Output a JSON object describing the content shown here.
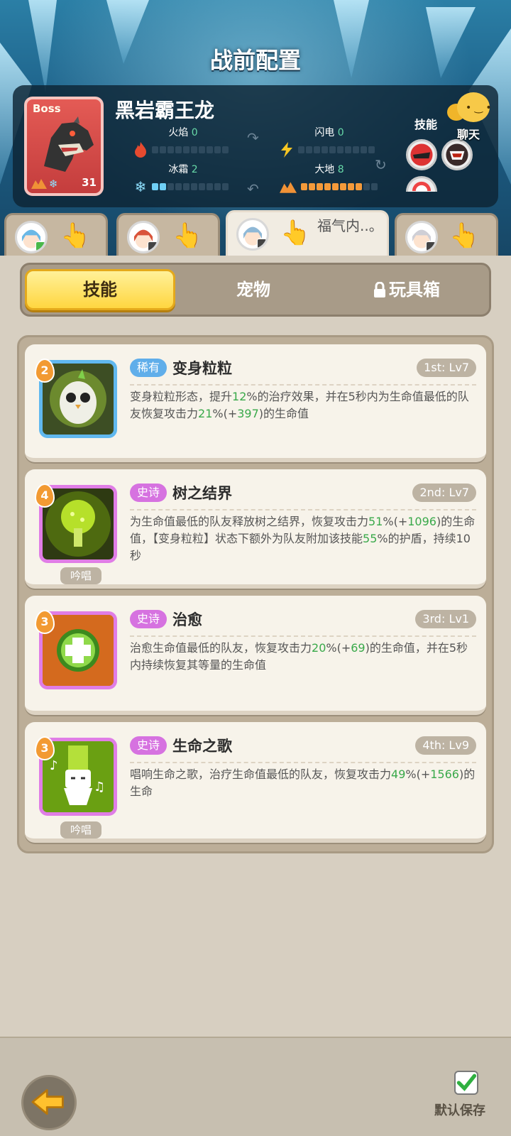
{
  "header": {
    "title": "战前配置"
  },
  "boss": {
    "tag": "Boss",
    "name": "黑岩霸王龙",
    "level": "31",
    "stats": {
      "fire": {
        "label": "火焰",
        "value": "0",
        "filled": 0
      },
      "lightning": {
        "label": "闪电",
        "value": "0",
        "filled": 0
      },
      "frost": {
        "label": "冰霜",
        "value": "2",
        "filled": 2
      },
      "earth": {
        "label": "大地",
        "value": "8",
        "filled": 8
      }
    },
    "skills_label": "技能"
  },
  "chat": {
    "label": "聊天"
  },
  "heroes": [
    {
      "name": ""
    },
    {
      "name": ""
    },
    {
      "name": "福气内..。"
    },
    {
      "name": ""
    }
  ],
  "tabs": [
    {
      "label": "技能",
      "active": true
    },
    {
      "label": "宠物",
      "active": false
    },
    {
      "label": "玩具箱",
      "active": false,
      "locked": true
    }
  ],
  "skills": [
    {
      "cost": "2",
      "rarity": "稀有",
      "name": "变身粒粒",
      "slot": "1st: Lv7",
      "desc_parts": [
        "变身粒粒形态，提升",
        "12",
        "%的治疗效果，并在5秒内为生命值最低的队友恢复攻击力",
        "21",
        "%(+",
        "397",
        ")的生命值"
      ],
      "chant": ""
    },
    {
      "cost": "4",
      "rarity": "史诗",
      "name": "树之结界",
      "slot": "2nd: Lv7",
      "desc_parts": [
        "为生命值最低的队友释放树之结界，恢复攻击力",
        "51",
        "%(+",
        "1096",
        ")的生命值，【变身粒粒】状态下额外为队友附加该技能",
        "55",
        "%的护盾，持续10秒"
      ],
      "chant": "吟唱"
    },
    {
      "cost": "3",
      "rarity": "史诗",
      "name": "治愈",
      "slot": "3rd: Lv1",
      "desc_parts": [
        "治愈生命值最低的队友，恢复攻击力",
        "20",
        "%(+",
        "69",
        ")的生命值，并在5秒内持续恢复其等量的生命值"
      ],
      "chant": ""
    },
    {
      "cost": "3",
      "rarity": "史诗",
      "name": "生命之歌",
      "slot": "4th: Lv9",
      "desc_parts": [
        "唱响生命之歌，治疗生命值最低的队友，恢复攻击力",
        "49",
        "%(+",
        "1566",
        ")的生命"
      ],
      "chant": "吟唱"
    }
  ],
  "footer": {
    "save_label": "默认保存"
  },
  "colors": {
    "highlight_green": "#39a94a",
    "rare": "#60aeea",
    "epic": "#d672e0",
    "tab_active": "#ffd640"
  }
}
